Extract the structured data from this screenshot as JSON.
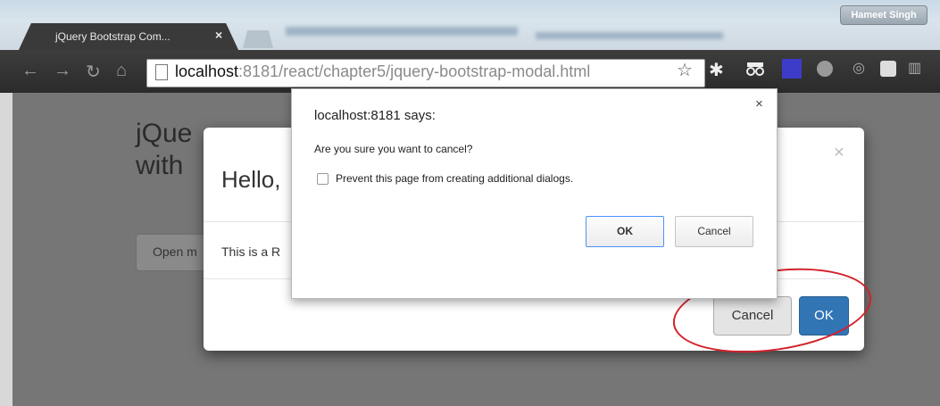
{
  "browser": {
    "tab_title": "jQuery Bootstrap Com...",
    "user_badge": "Hameet Singh",
    "url_host": "localhost",
    "url_path": ":8181/react/chapter5/jquery-bootstrap-modal.html"
  },
  "page": {
    "heading_line1": "jQue",
    "heading_line2": "with",
    "open_button": "Open m"
  },
  "bootstrap_modal": {
    "title": "Hello,",
    "close_glyph": "×",
    "body": "This is a R",
    "cancel_label": "Cancel",
    "ok_label": "OK"
  },
  "alert": {
    "title": "localhost:8181 says:",
    "close_glyph": "×",
    "message": "Are you sure you want to cancel?",
    "checkbox_label": "Prevent this page from creating additional dialogs.",
    "ok_label": "OK",
    "cancel_label": "Cancel"
  },
  "annotation": {
    "color": "#d4202a"
  }
}
